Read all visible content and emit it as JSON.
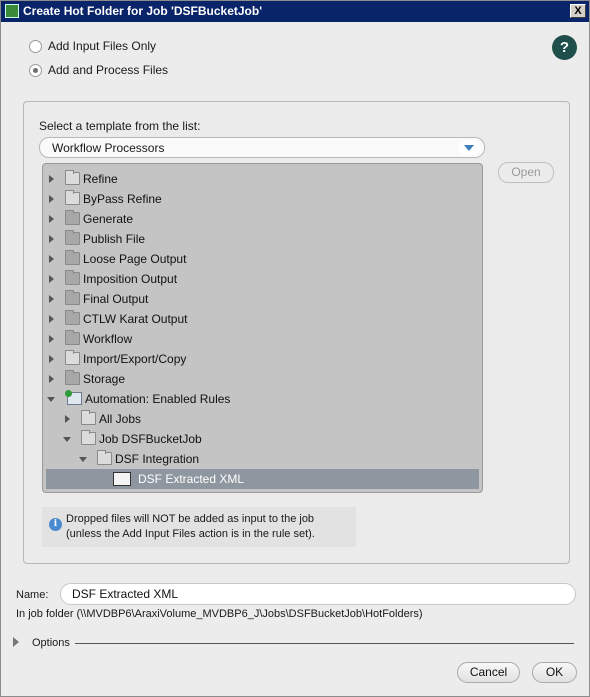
{
  "window": {
    "title": "Create Hot Folder for Job 'DSFBucketJob'",
    "close_label": "X"
  },
  "mode": {
    "options": [
      {
        "label": "Add Input Files Only",
        "selected": false
      },
      {
        "label": "Add and Process Files",
        "selected": true
      }
    ]
  },
  "help_label": "?",
  "template": {
    "prompt": "Select a template from the list:",
    "selected": "Workflow Processors",
    "open_label": "Open"
  },
  "tree": [
    {
      "label": "Refine",
      "expanded": false,
      "icon": "open-folder-icon"
    },
    {
      "label": "ByPass Refine",
      "expanded": false,
      "icon": "open-folder-icon"
    },
    {
      "label": "Generate",
      "expanded": false,
      "icon": "folder-icon"
    },
    {
      "label": "Publish File",
      "expanded": false,
      "icon": "folder-icon"
    },
    {
      "label": "Loose Page Output",
      "expanded": false,
      "icon": "folder-icon"
    },
    {
      "label": "Imposition Output",
      "expanded": false,
      "icon": "folder-icon"
    },
    {
      "label": "Final Output",
      "expanded": false,
      "icon": "folder-icon"
    },
    {
      "label": "CTLW Karat Output",
      "expanded": false,
      "icon": "folder-icon"
    },
    {
      "label": "Workflow",
      "expanded": false,
      "icon": "folder-icon"
    },
    {
      "label": "Import/Export/Copy",
      "expanded": false,
      "icon": "open-folder-icon"
    },
    {
      "label": "Storage",
      "expanded": false,
      "icon": "folder-icon"
    },
    {
      "label": "Automation: Enabled Rules",
      "expanded": true,
      "icon": "automation-icon"
    },
    {
      "label": "All Jobs",
      "expanded": false,
      "icon": "open-folder-icon"
    },
    {
      "label": "Job DSFBucketJob",
      "expanded": true,
      "icon": "open-folder-icon"
    },
    {
      "label": "DSF Integration",
      "expanded": true,
      "icon": "open-folder-icon"
    },
    {
      "label": "DSF Extracted XML",
      "selected": true,
      "icon": "xml-rule-icon"
    }
  ],
  "note": {
    "line1": "Dropped files will NOT be added as input to the job",
    "line2": "(unless the Add Input Files action is in the rule set)."
  },
  "name": {
    "label": "Name:",
    "value": "DSF Extracted XML",
    "folder_text": "In job folder (\\\\MVDBP6\\AraxiVolume_MVDBP6_J\\Jobs\\DSFBucketJob\\HotFolders)"
  },
  "options_label": "Options",
  "buttons": {
    "cancel": "Cancel",
    "ok": "OK"
  }
}
